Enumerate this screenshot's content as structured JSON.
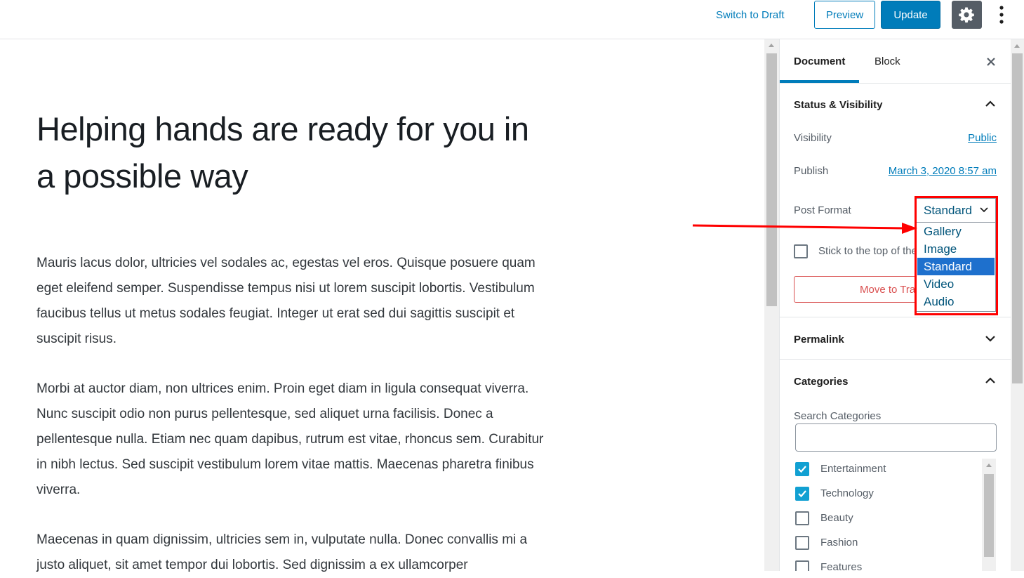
{
  "header": {
    "switch_to_draft": "Switch to Draft",
    "preview": "Preview",
    "update": "Update",
    "settings_icon": "gear-icon",
    "more_icon": "vertical-ellipsis-icon"
  },
  "post": {
    "title": "Helping hands are ready for you in a possible way",
    "paragraphs": [
      "Mauris lacus dolor, ultricies vel sodales ac, egestas vel eros. Quisque posuere quam eget eleifend semper. Suspendisse tempus nisi ut lorem suscipit lobortis. Vestibulum faucibus tellus ut metus sodales feugiat. Integer ut erat sed dui sagittis suscipit et suscipit risus.",
      "Morbi at auctor diam, non ultrices enim. Proin eget diam in ligula consequat viverra. Nunc suscipit odio non purus pellentesque, sed aliquet urna facilisis. Donec a pellentesque nulla. Etiam nec quam dapibus, rutrum est vitae, rhoncus sem. Curabitur in nibh lectus. Sed suscipit vestibulum lorem vitae mattis. Maecenas pharetra finibus viverra.",
      "Maecenas in quam dignissim, ultricies sem in, vulputate nulla. Donec convallis mi a justo aliquet, sit amet tempor dui lobortis. Sed dignissim a ex ullamcorper"
    ]
  },
  "sidebar": {
    "tabs": [
      "Document",
      "Block"
    ],
    "active_tab": "Document",
    "close_icon": "close-icon",
    "status_visibility": {
      "title": "Status & Visibility",
      "visibility_label": "Visibility",
      "visibility_value": "Public",
      "publish_label": "Publish",
      "publish_value": "March 3, 2020 8:57 am",
      "post_format_label": "Post Format",
      "post_format_selected": "Standard",
      "post_format_options": [
        "Gallery",
        "Image",
        "Standard",
        "Video",
        "Audio"
      ],
      "stick_label": "Stick to the top of the blog",
      "stick_checked": false,
      "move_to_trash": "Move to Trash"
    },
    "permalink": {
      "title": "Permalink"
    },
    "categories": {
      "title": "Categories",
      "search_label": "Search Categories",
      "search_value": "",
      "items": [
        {
          "label": "Entertainment",
          "checked": true
        },
        {
          "label": "Technology",
          "checked": true
        },
        {
          "label": "Beauty",
          "checked": false
        },
        {
          "label": "Fashion",
          "checked": false
        },
        {
          "label": "Features",
          "checked": false
        }
      ]
    }
  },
  "colors": {
    "accent": "#007cba",
    "annotation_red": "#ff0000",
    "selected_option": "#1e70cd",
    "checkbox_checked": "#11a0d2"
  }
}
